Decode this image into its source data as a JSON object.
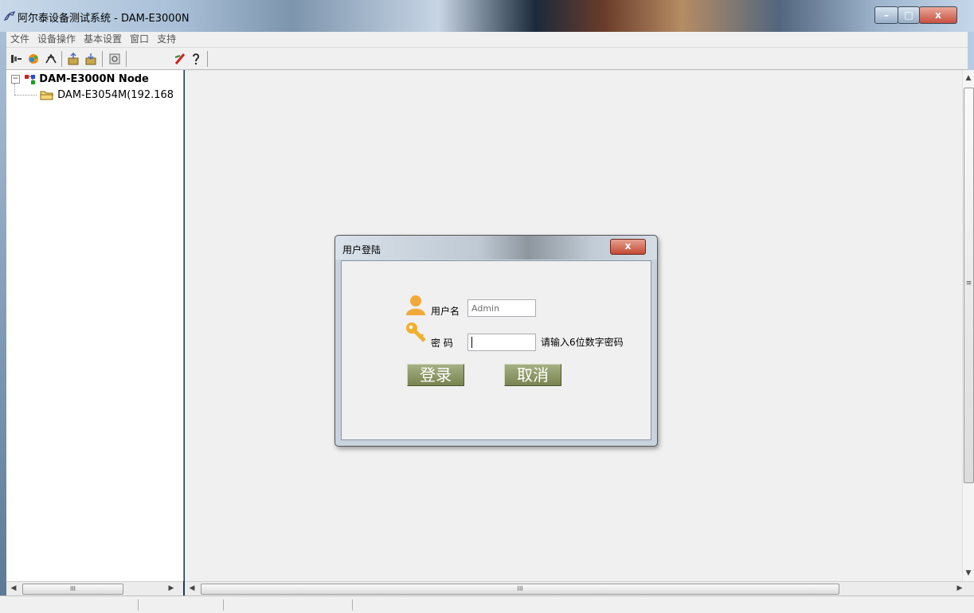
{
  "window": {
    "title": "阿尔泰设备测试系统 - DAM-E3000N",
    "min": "–",
    "max": "□",
    "close": "x"
  },
  "menu": [
    "文件",
    "设备操作",
    "基本设置",
    "窗口",
    "支持"
  ],
  "toolbar": {
    "icons": [
      "connect-icon",
      "search-device-icon",
      "disconnect-icon",
      "upload-icon",
      "download-icon",
      "settings-icon",
      "paint-icon",
      "help-icon"
    ]
  },
  "tree": {
    "root": "DAM-E3000N Node",
    "child": "DAM-E3054M(192.168"
  },
  "scroll": {
    "h_grip": "III",
    "v_grip": "≡"
  },
  "dialog": {
    "title": "用户登陆",
    "close": "x",
    "username_label": "用户名",
    "username_value": "Admin",
    "password_label": "密 码",
    "password_value": "",
    "password_hint": "请输入6位数字密码",
    "login_button": "登录",
    "cancel_button": "取消"
  },
  "colors": {
    "button_green": "#8a9563",
    "close_red": "#c75040",
    "user_icon": "#f2a93b",
    "key_icon": "#f0b030"
  }
}
